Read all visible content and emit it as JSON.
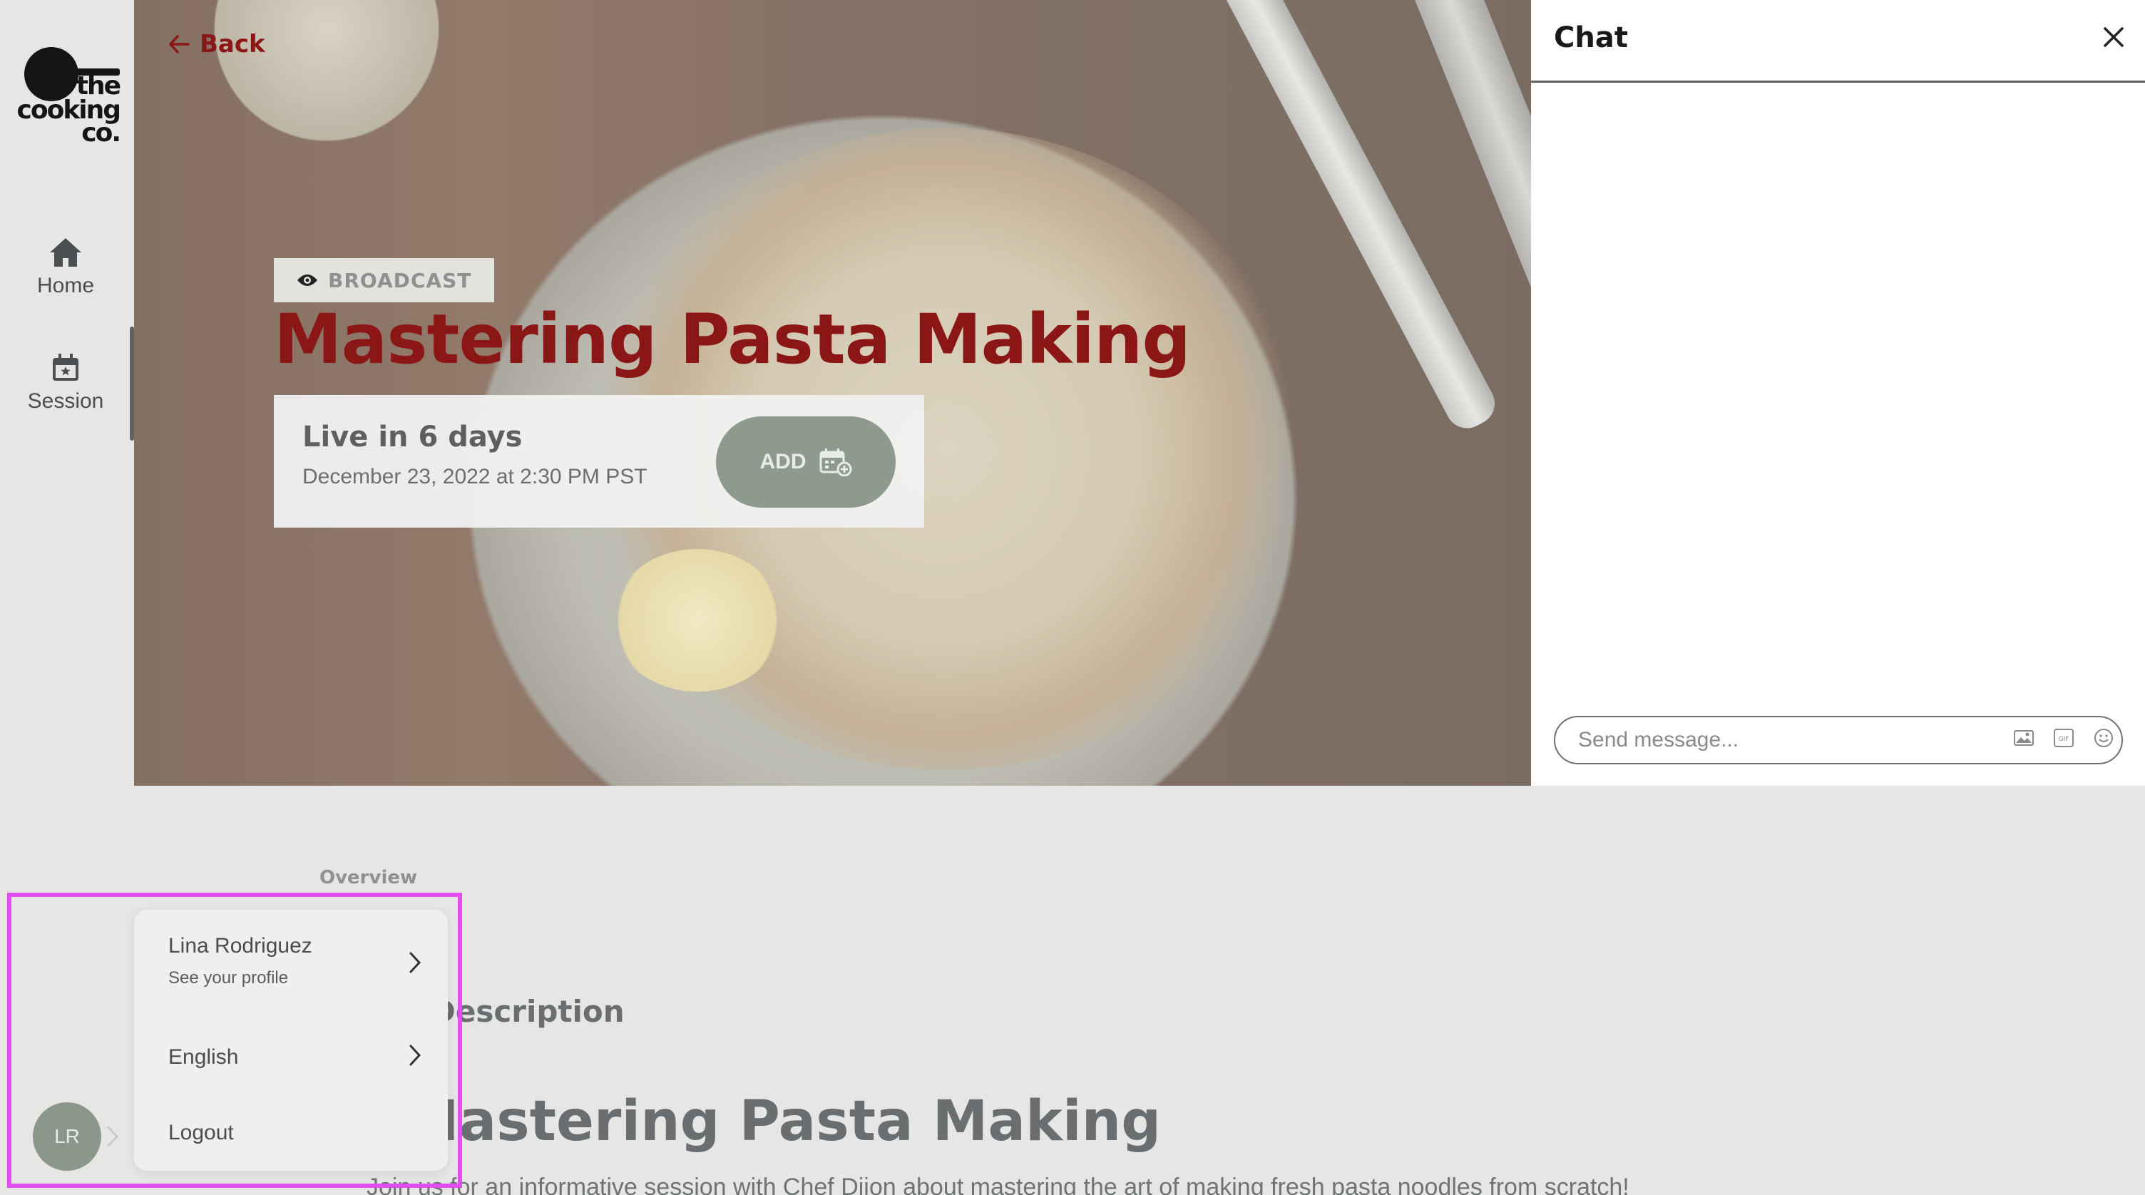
{
  "sidebar": {
    "logo": {
      "line1": "the",
      "line2": "cooking",
      "line3": "co."
    },
    "items": [
      {
        "label": "Home",
        "icon": "home-icon"
      },
      {
        "label": "Session",
        "icon": "calendar-star-icon"
      }
    ]
  },
  "hero": {
    "back_label": "Back",
    "badge_label": "BROADCAST",
    "badge_icon": "eye-icon",
    "title": "Mastering Pasta Making",
    "live_title": "Live in 6 days",
    "live_date": "December 23, 2022 at 2:30 PM PST",
    "add_label": "ADD",
    "add_icon": "calendar-add-icon",
    "accent_color": "#8b1616"
  },
  "chat": {
    "title": "Chat",
    "input_placeholder": "Send message...",
    "icons": [
      "image-icon",
      "gif-icon",
      "emoji-icon"
    ]
  },
  "content": {
    "tab_overview": "Overview",
    "description_label": "Description",
    "description_title": "Mastering Pasta Making",
    "description_text": "Join us for an informative session with Chef Dijon about mastering the art of making fresh pasta noodles from scratch!"
  },
  "user_menu": {
    "avatar_initials": "LR",
    "name": "Lina Rodriguez",
    "profile_link": "See your profile",
    "language": "English",
    "logout": "Logout"
  }
}
